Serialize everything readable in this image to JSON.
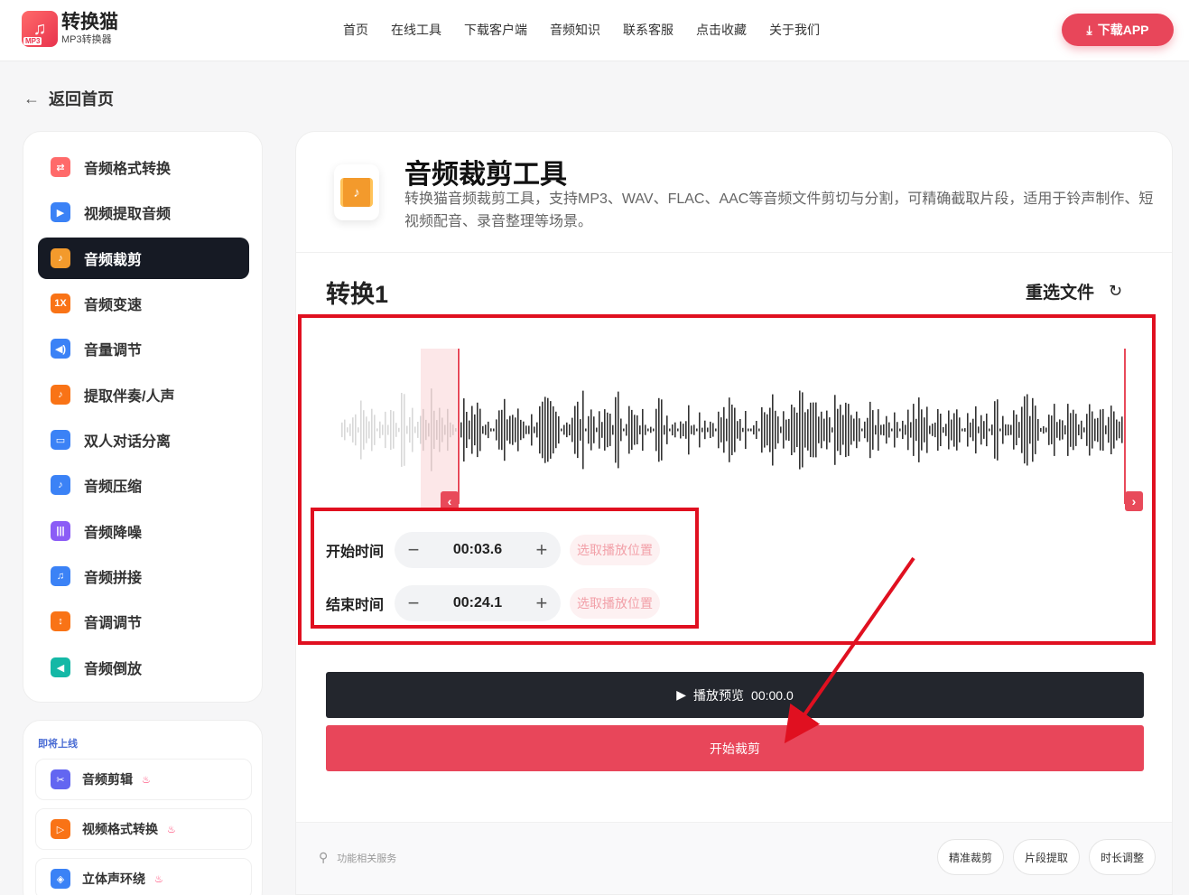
{
  "header": {
    "logo_title": "转换猫",
    "logo_sub": "MP3转换器",
    "logo_tag": "MP3",
    "nav": [
      "首页",
      "在线工具",
      "下载客户端",
      "音频知识",
      "联系客服",
      "点击收藏",
      "关于我们"
    ],
    "download_label": "下载APP"
  },
  "back_label": "返回首页",
  "sidebar": {
    "items": [
      {
        "label": "音频格式转换",
        "icon": "format-convert-icon",
        "color": "#ff6a6a"
      },
      {
        "label": "视频提取音频",
        "icon": "video-extract-icon",
        "color": "#3b82f6"
      },
      {
        "label": "音频裁剪",
        "icon": "audio-cut-icon",
        "color": "#f39a2c"
      },
      {
        "label": "音频变速",
        "icon": "speed-icon",
        "color": "#f97316"
      },
      {
        "label": "音量调节",
        "icon": "volume-icon",
        "color": "#3b82f6"
      },
      {
        "label": "提取伴奏/人声",
        "icon": "vocal-icon",
        "color": "#f97316"
      },
      {
        "label": "双人对话分离",
        "icon": "dialog-icon",
        "color": "#3b82f6"
      },
      {
        "label": "音频压缩",
        "icon": "compress-icon",
        "color": "#3b82f6"
      },
      {
        "label": "音频降噪",
        "icon": "denoise-icon",
        "color": "#8b5cf6"
      },
      {
        "label": "音频拼接",
        "icon": "merge-icon",
        "color": "#3b82f6"
      },
      {
        "label": "音调调节",
        "icon": "pitch-icon",
        "color": "#f97316"
      },
      {
        "label": "音频倒放",
        "icon": "reverse-icon",
        "color": "#14b8a6"
      }
    ],
    "active_index": 2
  },
  "coming_soon": {
    "title": "即将上线",
    "items": [
      {
        "label": "音频剪辑",
        "icon": "scissors-icon",
        "color": "#6366f1"
      },
      {
        "label": "视频格式转换",
        "icon": "video-format-icon",
        "color": "#f97316"
      },
      {
        "label": "立体声环绕",
        "icon": "cube-icon",
        "color": "#3b82f6"
      }
    ]
  },
  "tool": {
    "title": "音频裁剪工具",
    "description": "转换猫音频裁剪工具，支持MP3、WAV、FLAC、AAC等音频文件剪切与分割，可精确截取片段，适用于铃声制作、短视频配音、录音整理等场景。"
  },
  "task": {
    "name": "转换1",
    "reselect_label": "重选文件"
  },
  "start_time": {
    "label": "开始时间",
    "value": "00:03.6",
    "pick_label": "选取播放位置"
  },
  "end_time": {
    "label": "结束时间",
    "value": "00:24.1",
    "pick_label": "选取播放位置"
  },
  "selection": {
    "start_fraction": 0.15,
    "end_fraction": 1.0
  },
  "play_button": {
    "label": "播放预览",
    "time": "00:00.0"
  },
  "start_button_label": "开始裁剪",
  "related": {
    "label": "功能相关服务",
    "tags": [
      "精准裁剪",
      "片段提取",
      "时长调整"
    ]
  },
  "colors": {
    "accent": "#e8465a",
    "dark": "#161a24",
    "highlight": "#e01020"
  }
}
